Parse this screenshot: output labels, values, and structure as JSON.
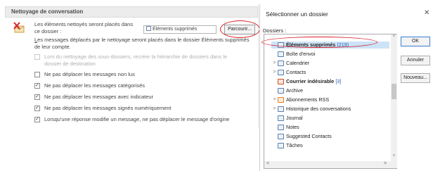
{
  "left": {
    "section_title": "Nettoyage de conversation",
    "dest_text": "Les éléments nettoyés seront placés dans ce dossier :",
    "folder_value": "Éléments supprimés",
    "browse_label": "Parcourir...",
    "moved_text_underlined": "L",
    "moved_text_rest": "es messages déplacés par le nettoyage seront placés dans le dossier Éléments supprimés de leur compte.",
    "options": [
      {
        "label": "Lors du nettoyage des sous-dossiers, recréer la hiérarchie de dossiers dans le dossier de destination",
        "checked": false,
        "disabled": true
      },
      {
        "label": "Ne pas déplacer les messages non lus",
        "checked": false,
        "disabled": false
      },
      {
        "label": "Ne pas déplacer les messages catégorisés",
        "checked": true,
        "disabled": false
      },
      {
        "label": "Ne pas déplacer les messages avec indicateur",
        "checked": true,
        "disabled": false
      },
      {
        "label": "Ne pas déplacer les messages signés numériquement",
        "checked": true,
        "disabled": false
      },
      {
        "label": "Lorsqu'une réponse modifie un message, ne pas déplacer le message d'origine",
        "checked": true,
        "disabled": false
      }
    ]
  },
  "dialog": {
    "title": "Sélectionner un dossier",
    "close_glyph": "✕",
    "folders_label": "Dossiers :",
    "tree": [
      {
        "label": "Éléments supprimés",
        "count": "(219)",
        "bold": true,
        "selected": true,
        "chevron": "",
        "icon": "trash-folder-icon"
      },
      {
        "label": "Boîte d'envoi",
        "count": "",
        "bold": false,
        "selected": false,
        "chevron": "",
        "icon": "outbox-folder-icon"
      },
      {
        "label": "Calendrier",
        "count": "",
        "bold": false,
        "selected": false,
        "chevron": ">",
        "icon": "calendar-folder-icon"
      },
      {
        "label": "Contacts",
        "count": "",
        "bold": false,
        "selected": false,
        "chevron": ">",
        "icon": "contacts-folder-icon"
      },
      {
        "label": "Courrier indésirable",
        "count": "[3]",
        "bold": true,
        "selected": false,
        "chevron": "",
        "icon": "junk-folder-icon"
      },
      {
        "label": "Archive",
        "count": "",
        "bold": false,
        "selected": false,
        "chevron": "",
        "icon": "folder-icon"
      },
      {
        "label": "Abonnements RSS",
        "count": "",
        "bold": false,
        "selected": false,
        "chevron": ">",
        "icon": "rss-folder-icon"
      },
      {
        "label": "Historique des conversations",
        "count": "",
        "bold": false,
        "selected": false,
        "chevron": ">",
        "icon": "folder-icon"
      },
      {
        "label": "Journal",
        "count": "",
        "bold": false,
        "selected": false,
        "chevron": "",
        "icon": "journal-folder-icon"
      },
      {
        "label": "Notes",
        "count": "",
        "bold": false,
        "selected": false,
        "chevron": "",
        "icon": "notes-folder-icon"
      },
      {
        "label": "Suggested Contacts",
        "count": "",
        "bold": false,
        "selected": false,
        "chevron": "",
        "icon": "contacts-folder-icon"
      },
      {
        "label": "Tâches",
        "count": "",
        "bold": false,
        "selected": false,
        "chevron": "",
        "icon": "tasks-folder-icon"
      }
    ],
    "buttons": {
      "ok": "OK",
      "cancel": "Annuler",
      "new": "Nouveau..."
    },
    "scroll": {
      "up": "˄",
      "down": "˅",
      "left": "<",
      "right": ">"
    }
  },
  "colors": {
    "annotation": "#d6222a",
    "selection": "#cde3f7",
    "link_count": "#2a5db0"
  }
}
